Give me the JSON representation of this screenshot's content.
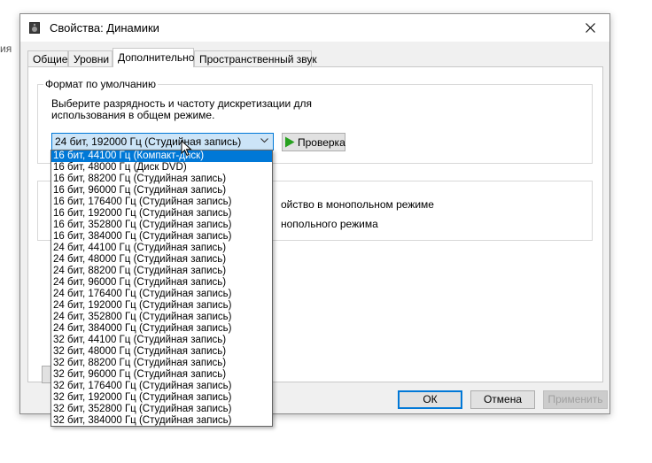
{
  "background": {
    "fragment": "ия"
  },
  "window": {
    "title": "Свойства: Динамики"
  },
  "tabs": [
    {
      "label": "Общие",
      "active": false
    },
    {
      "label": "Уровни",
      "active": false
    },
    {
      "label": "Дополнительно",
      "active": true
    },
    {
      "label": "Пространственный звук",
      "active": false
    }
  ],
  "default_format": {
    "group_title": "Формат по умолчанию",
    "description": "Выберите разрядность и частоту дискретизации для использования в общем режиме.",
    "selected_value": "24 бит, 192000 Гц (Студийная запись)",
    "test_button": "Проверка"
  },
  "exclusive_mode": {
    "text_1": "ойство в монопольном режиме",
    "text_2": "нопольного режима"
  },
  "dropdown": {
    "selected_index": 0,
    "options": [
      "16 бит, 44100 Гц (Компакт-диск)",
      "16 бит, 48000 Гц (Диск DVD)",
      "16 бит, 88200 Гц (Студийная запись)",
      "16 бит, 96000 Гц (Студийная запись)",
      "16 бит, 176400 Гц (Студийная запись)",
      "16 бит, 192000 Гц (Студийная запись)",
      "16 бит, 352800 Гц (Студийная запись)",
      "16 бит, 384000 Гц (Студийная запись)",
      "24 бит, 44100 Гц (Студийная запись)",
      "24 бит, 48000 Гц (Студийная запись)",
      "24 бит, 88200 Гц (Студийная запись)",
      "24 бит, 96000 Гц (Студийная запись)",
      "24 бит, 176400 Гц (Студийная запись)",
      "24 бит, 192000 Гц (Студийная запись)",
      "24 бит, 352800 Гц (Студийная запись)",
      "24 бит, 384000 Гц (Студийная запись)",
      "32 бит, 44100 Гц (Студийная запись)",
      "32 бит, 48000 Гц (Студийная запись)",
      "32 бит, 88200 Гц (Студийная запись)",
      "32 бит, 96000 Гц (Студийная запись)",
      "32 бит, 176400 Гц (Студийная запись)",
      "32 бит, 192000 Гц (Студийная запись)",
      "32 бит, 352800 Гц (Студийная запись)",
      "32 бит, 384000 Гц (Студийная запись)"
    ]
  },
  "buttons": {
    "ok": "ОК",
    "cancel": "Отмена",
    "apply": "Применить"
  },
  "colors": {
    "accent": "#0078d7",
    "selection": "#0078d7",
    "combo_fill": "#cce4f7"
  },
  "icons": {
    "title": "speaker-icon",
    "close": "close-icon",
    "test": "play-icon",
    "combo": "chevron-down-icon"
  }
}
